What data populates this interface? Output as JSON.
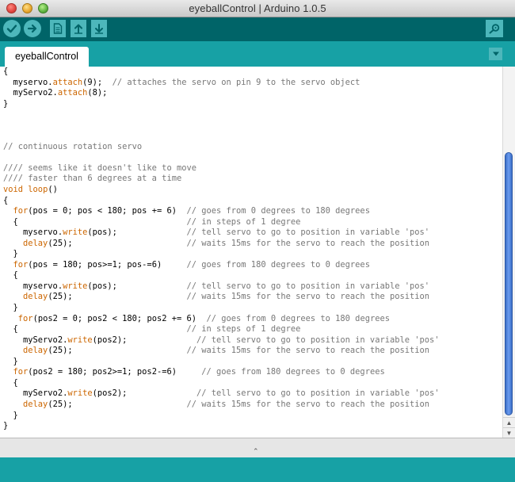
{
  "window": {
    "title": "eyeballControl | Arduino 1.0.5"
  },
  "toolbar": {
    "buttons": [
      {
        "name": "verify",
        "icon": "checkmark-icon"
      },
      {
        "name": "upload",
        "icon": "arrow-right-icon"
      },
      {
        "name": "new",
        "icon": "document-icon"
      },
      {
        "name": "open",
        "icon": "arrow-up-icon"
      },
      {
        "name": "save",
        "icon": "arrow-down-icon"
      },
      {
        "name": "serial-monitor",
        "icon": "magnifier-icon"
      }
    ]
  },
  "tabs": [
    {
      "label": "eyeballControl",
      "active": true
    }
  ],
  "colors": {
    "toolbar_bg": "#006468",
    "tabstrip_bg": "#17a1a5",
    "button_bg": "#4db7bb",
    "keyword": "#cc6600",
    "comment": "#777777"
  },
  "code_lines": [
    [
      [
        "{",
        "plain"
      ]
    ],
    [
      [
        "  myservo.",
        "plain"
      ],
      [
        "attach",
        "kw"
      ],
      [
        "(9);  ",
        "plain"
      ],
      [
        "// attaches the servo on pin 9 to the servo object",
        "cm"
      ]
    ],
    [
      [
        "  myServo2.",
        "plain"
      ],
      [
        "attach",
        "kw"
      ],
      [
        "(8);",
        "plain"
      ]
    ],
    [
      [
        "}",
        "plain"
      ]
    ],
    [
      [
        "",
        "plain"
      ]
    ],
    [
      [
        "",
        "plain"
      ]
    ],
    [
      [
        "",
        "plain"
      ]
    ],
    [
      [
        "// continuous rotation servo",
        "cm"
      ]
    ],
    [
      [
        "",
        "plain"
      ]
    ],
    [
      [
        "//// seems like it doesn't like to move",
        "cm"
      ]
    ],
    [
      [
        "//// faster than 6 degrees at a time",
        "cm"
      ]
    ],
    [
      [
        "void",
        "kw"
      ],
      [
        " ",
        "plain"
      ],
      [
        "loop",
        "kw"
      ],
      [
        "()",
        "plain"
      ]
    ],
    [
      [
        "{",
        "plain"
      ]
    ],
    [
      [
        "  ",
        "plain"
      ],
      [
        "for",
        "kw"
      ],
      [
        "(pos = 0; pos < 180; pos += 6)  ",
        "plain"
      ],
      [
        "// goes from 0 degrees to 180 degrees",
        "cm"
      ]
    ],
    [
      [
        "  {                                  ",
        "plain"
      ],
      [
        "// in steps of 1 degree",
        "cm"
      ]
    ],
    [
      [
        "    myservo.",
        "plain"
      ],
      [
        "write",
        "kw"
      ],
      [
        "(pos);              ",
        "plain"
      ],
      [
        "// tell servo to go to position in variable 'pos'",
        "cm"
      ]
    ],
    [
      [
        "    ",
        "plain"
      ],
      [
        "delay",
        "kw"
      ],
      [
        "(25);                       ",
        "plain"
      ],
      [
        "// waits 15ms for the servo to reach the position",
        "cm"
      ]
    ],
    [
      [
        "  }",
        "plain"
      ]
    ],
    [
      [
        "  ",
        "plain"
      ],
      [
        "for",
        "kw"
      ],
      [
        "(pos = 180; pos>=1; pos-=6)     ",
        "plain"
      ],
      [
        "// goes from 180 degrees to 0 degrees",
        "cm"
      ]
    ],
    [
      [
        "  {",
        "plain"
      ]
    ],
    [
      [
        "    myservo.",
        "plain"
      ],
      [
        "write",
        "kw"
      ],
      [
        "(pos);              ",
        "plain"
      ],
      [
        "// tell servo to go to position in variable 'pos'",
        "cm"
      ]
    ],
    [
      [
        "    ",
        "plain"
      ],
      [
        "delay",
        "kw"
      ],
      [
        "(25);                       ",
        "plain"
      ],
      [
        "// waits 15ms for the servo to reach the position",
        "cm"
      ]
    ],
    [
      [
        "  }",
        "plain"
      ]
    ],
    [
      [
        "   ",
        "plain"
      ],
      [
        "for",
        "kw"
      ],
      [
        "(pos2 = 0; pos2 < 180; pos2 += 6)  ",
        "plain"
      ],
      [
        "// goes from 0 degrees to 180 degrees",
        "cm"
      ]
    ],
    [
      [
        "  {                                  ",
        "plain"
      ],
      [
        "// in steps of 1 degree",
        "cm"
      ]
    ],
    [
      [
        "    myServo2.",
        "plain"
      ],
      [
        "write",
        "kw"
      ],
      [
        "(pos2);              ",
        "plain"
      ],
      [
        "// tell servo to go to position in variable 'pos'",
        "cm"
      ]
    ],
    [
      [
        "    ",
        "plain"
      ],
      [
        "delay",
        "kw"
      ],
      [
        "(25);                       ",
        "plain"
      ],
      [
        "// waits 15ms for the servo to reach the position",
        "cm"
      ]
    ],
    [
      [
        "  }",
        "plain"
      ]
    ],
    [
      [
        "  ",
        "plain"
      ],
      [
        "for",
        "kw"
      ],
      [
        "(pos2 = 180; pos2>=1; pos2-=6)     ",
        "plain"
      ],
      [
        "// goes from 180 degrees to 0 degrees",
        "cm"
      ]
    ],
    [
      [
        "  {",
        "plain"
      ]
    ],
    [
      [
        "    myServo2.",
        "plain"
      ],
      [
        "write",
        "kw"
      ],
      [
        "(pos2);              ",
        "plain"
      ],
      [
        "// tell servo to go to position in variable 'pos'",
        "cm"
      ]
    ],
    [
      [
        "    ",
        "plain"
      ],
      [
        "delay",
        "kw"
      ],
      [
        "(25);                       ",
        "plain"
      ],
      [
        "// waits 15ms for the servo to reach the position",
        "cm"
      ]
    ],
    [
      [
        "  }",
        "plain"
      ]
    ],
    [
      [
        "}",
        "plain"
      ]
    ]
  ]
}
